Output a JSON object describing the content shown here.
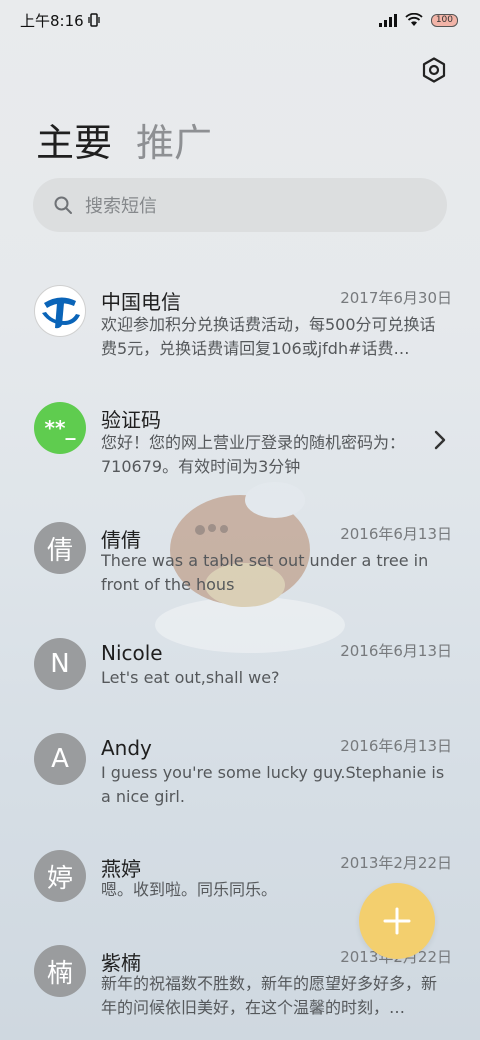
{
  "status": {
    "time": "上午8:16",
    "battery": "100"
  },
  "tabs": [
    {
      "label": "主要"
    },
    {
      "label": "推广"
    }
  ],
  "search": {
    "placeholder": "搜索短信"
  },
  "conversations": [
    {
      "avatar": "",
      "name": "中国电信",
      "date": "2017年6月30日",
      "message": "欢迎参加积分兑换话费活动，每500分可兑换话费5元，兑换话费请回复106或jfdh#话费…"
    },
    {
      "avatar": "**_",
      "name": "验证码",
      "date": "",
      "message": "您好！您的网上营业厅登录的随机密码为：710679。有效时间为3分钟"
    },
    {
      "avatar": "倩",
      "name": "倩倩",
      "date": "2016年6月13日",
      "message": "There was a table set out under a tree in front of the hous"
    },
    {
      "avatar": "N",
      "name": "Nicole",
      "date": "2016年6月13日",
      "message": "Let's eat out,shall we?"
    },
    {
      "avatar": "A",
      "name": "Andy",
      "date": "2016年6月13日",
      "message": "I guess you're some lucky guy.Stephanie is a nice girl."
    },
    {
      "avatar": "婷",
      "name": "燕婷",
      "date": "2013年2月22日",
      "message": "嗯。收到啦。同乐同乐。"
    },
    {
      "avatar": "楠",
      "name": "紫楠",
      "date": "2013年2月22日",
      "message": "新年的祝福数不胜数，新年的愿望好多好多，新年的问候依旧美好，在这个温馨的时刻，…"
    }
  ],
  "icons": {
    "settings": "settings-icon",
    "search": "search-icon",
    "add": "add-icon",
    "chevron": "chevron-right-icon"
  },
  "colors": {
    "fab": "#f3cf6e",
    "verification_avatar": "#5fcc4f",
    "avatar_gray": "#9a9c9e"
  }
}
